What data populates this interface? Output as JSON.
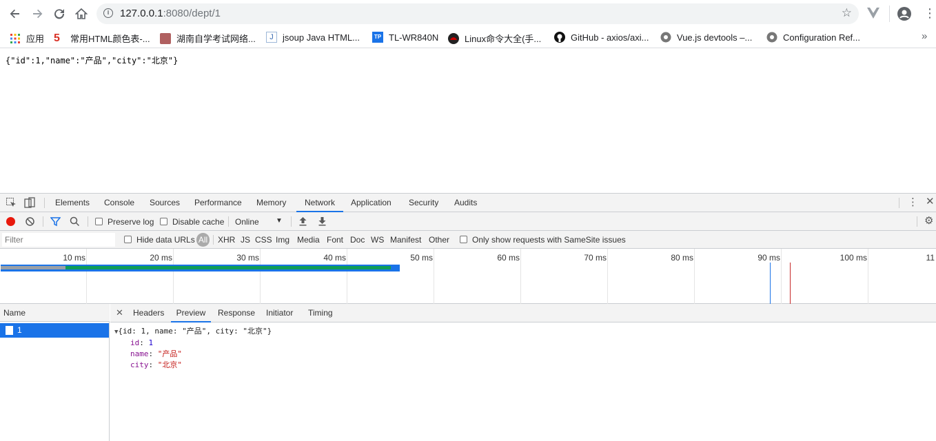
{
  "browser": {
    "url_host": "127.0.0.1",
    "url_path": ":8080/dept/1"
  },
  "bookmarks": [
    {
      "label": "应用",
      "icon": "apps-grid-icon"
    },
    {
      "label": "常用HTML颜色表-...",
      "icon": "site-5-icon"
    },
    {
      "label": "湖南自学考试网络...",
      "icon": "site-icon"
    },
    {
      "label": "jsoup Java HTML...",
      "icon": "site-j-icon"
    },
    {
      "label": "TL-WR840N",
      "icon": "tp-link-icon"
    },
    {
      "label": "Linux命令大全(手...",
      "icon": "redhat-icon"
    },
    {
      "label": "GitHub - axios/axi...",
      "icon": "github-icon"
    },
    {
      "label": "Vue.js devtools –...",
      "icon": "chrome-web-icon"
    },
    {
      "label": "Configuration Ref...",
      "icon": "chrome-web-icon"
    }
  ],
  "page": {
    "json_text": "{\"id\":1,\"name\":\"产品\",\"city\":\"北京\"}"
  },
  "devtools": {
    "tabs": [
      "Elements",
      "Console",
      "Sources",
      "Performance",
      "Memory",
      "Network",
      "Application",
      "Security",
      "Audits"
    ],
    "active_tab": "Network",
    "toolbar": {
      "preserve_log": "Preserve log",
      "disable_cache": "Disable cache",
      "throttle": "Online"
    },
    "filter": {
      "placeholder": "Filter",
      "hide_data_urls": "Hide data URLs",
      "types": [
        "All",
        "XHR",
        "JS",
        "CSS",
        "Img",
        "Media",
        "Font",
        "Doc",
        "WS",
        "Manifest",
        "Other"
      ],
      "samesite": "Only show requests with SameSite issues"
    },
    "timeline_ticks": [
      "10 ms",
      "20 ms",
      "30 ms",
      "40 ms",
      "50 ms",
      "60 ms",
      "70 ms",
      "80 ms",
      "90 ms",
      "100 ms",
      "11"
    ],
    "name_header": "Name",
    "request_name": "1",
    "detail_tabs": [
      "Headers",
      "Preview",
      "Response",
      "Initiator",
      "Timing"
    ],
    "active_detail_tab": "Preview",
    "preview": {
      "summary": "{id: 1, name: \"产品\", city: \"北京\"}",
      "rows": [
        {
          "key": "id",
          "value": "1",
          "kind": "num"
        },
        {
          "key": "name",
          "value": "\"产品\"",
          "kind": "str"
        },
        {
          "key": "city",
          "value": "\"北京\"",
          "kind": "str"
        }
      ]
    }
  }
}
